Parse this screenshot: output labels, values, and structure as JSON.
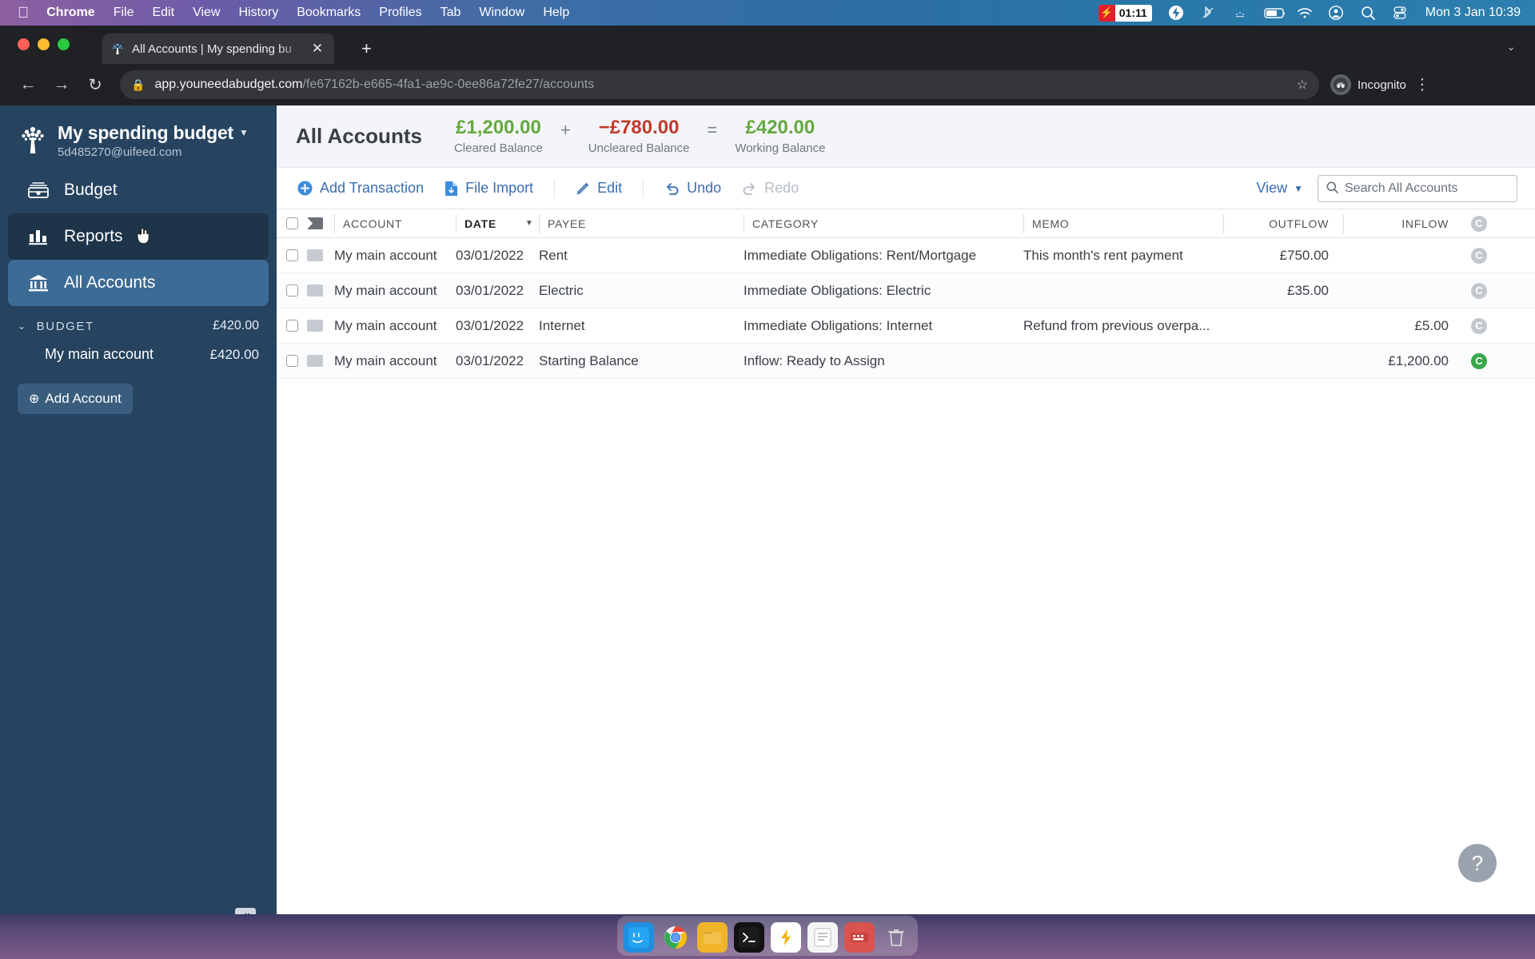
{
  "macbar": {
    "apple_icon": "apple-icon",
    "menus": [
      {
        "label": "Chrome",
        "bold": true
      },
      {
        "label": "File",
        "bold": false
      },
      {
        "label": "Edit",
        "bold": false
      },
      {
        "label": "View",
        "bold": false
      },
      {
        "label": "History",
        "bold": false
      },
      {
        "label": "Bookmarks",
        "bold": false
      },
      {
        "label": "Profiles",
        "bold": false
      },
      {
        "label": "Tab",
        "bold": false
      },
      {
        "label": "Window",
        "bold": false
      },
      {
        "label": "Help",
        "bold": false
      }
    ],
    "recording_time": "01:11",
    "clock": "Mon 3 Jan  10:39"
  },
  "browser": {
    "tab_title": "All Accounts | My spending bu",
    "close_label": "✕",
    "newtab_label": "+",
    "tabchev_label": "⌄",
    "back_label": "←",
    "forward_label": "→",
    "reload_label": "↻",
    "url_host": "app.youneedabudget.com",
    "url_path": "/fe67162b-e665-4fa1-ae9c-0ee86a72fe27/accounts",
    "star_label": "☆",
    "incognito_label": "Incognito",
    "kebab_label": "⋮"
  },
  "sidebar": {
    "budget_name": "My spending budget",
    "budget_email": "5d485270@uifeed.com",
    "caret": "▼",
    "nav": [
      {
        "label": "Budget",
        "icon": "budget-icon",
        "state": "normal"
      },
      {
        "label": "Reports",
        "icon": "reports-icon",
        "state": "hover"
      },
      {
        "label": "All Accounts",
        "icon": "bank-icon",
        "state": "active"
      }
    ],
    "section": {
      "chevron": "⌄",
      "label": "BUDGET",
      "amount": "£420.00"
    },
    "accounts": [
      {
        "name": "My main account",
        "amount": "£420.00"
      }
    ],
    "add_account_label": "Add Account",
    "add_account_icon": "⊕",
    "collapse_icon": "◀|"
  },
  "account_header": {
    "title": "All Accounts",
    "balances": [
      {
        "value": "£1,200.00",
        "label": "Cleared Balance",
        "color": "#64a93f"
      },
      {
        "value": "−£780.00",
        "label": "Uncleared Balance",
        "color": "#c0392b"
      },
      {
        "value": "£420.00",
        "label": "Working Balance",
        "color": "#64a93f"
      }
    ],
    "operators": [
      "+",
      "="
    ]
  },
  "toolbar": {
    "buttons": [
      {
        "label": "Add Transaction",
        "icon": "plus-circle-icon",
        "disabled": false
      },
      {
        "label": "File Import",
        "icon": "file-import-icon",
        "disabled": false
      },
      {
        "label": "Edit",
        "icon": "pencil-icon",
        "disabled": false
      },
      {
        "label": "Undo",
        "icon": "undo-icon",
        "disabled": false
      },
      {
        "label": "Redo",
        "icon": "redo-icon",
        "disabled": true
      }
    ],
    "view_label": "View",
    "view_chevron": "▼",
    "search_placeholder": "Search All Accounts",
    "search_value": ""
  },
  "table": {
    "columns": [
      "ACCOUNT",
      "DATE",
      "PAYEE",
      "CATEGORY",
      "MEMO",
      "OUTFLOW",
      "INFLOW"
    ],
    "sort_column": "DATE",
    "sort_arrow": "▼",
    "cleared_header_badge": "C",
    "rows": [
      {
        "account": "My main account",
        "date": "03/01/2022",
        "payee": "Rent",
        "category": "Immediate Obligations: Rent/Mortgage",
        "memo": "This month's rent payment",
        "outflow": "£750.00",
        "inflow": "",
        "cleared": "C",
        "cleared_state": "uncleared"
      },
      {
        "account": "My main account",
        "date": "03/01/2022",
        "payee": "Electric",
        "category": "Immediate Obligations: Electric",
        "memo": "",
        "outflow": "£35.00",
        "inflow": "",
        "cleared": "C",
        "cleared_state": "uncleared"
      },
      {
        "account": "My main account",
        "date": "03/01/2022",
        "payee": "Internet",
        "category": "Immediate Obligations: Internet",
        "memo": "Refund from previous overpa...",
        "outflow": "",
        "inflow": "£5.00",
        "cleared": "C",
        "cleared_state": "uncleared"
      },
      {
        "account": "My main account",
        "date": "03/01/2022",
        "payee": "Starting Balance",
        "category": "Inflow: Ready to Assign",
        "memo": "",
        "outflow": "",
        "inflow": "£1,200.00",
        "cleared": "C",
        "cleared_state": "cleared"
      }
    ]
  },
  "help_button_label": "?",
  "dock": [
    {
      "name": "finder-icon",
      "glyph": "🙂",
      "color": "#2196f3"
    },
    {
      "name": "chrome-icon",
      "glyph": "◉",
      "color": "#ffffff"
    },
    {
      "name": "files-icon",
      "glyph": "▤",
      "color": "#f0b429"
    },
    {
      "name": "terminal-icon",
      "glyph": "❯",
      "color": "#1c1c1c"
    },
    {
      "name": "bolt-icon",
      "glyph": "⚡",
      "color": "#ffd84d"
    },
    {
      "name": "notes-icon",
      "glyph": "▧",
      "color": "#f5f5f5"
    },
    {
      "name": "keyboard-icon",
      "glyph": "⌨",
      "color": "#d9534f"
    },
    {
      "name": "trash-icon",
      "glyph": "🗑",
      "color": "#cccccc"
    }
  ]
}
